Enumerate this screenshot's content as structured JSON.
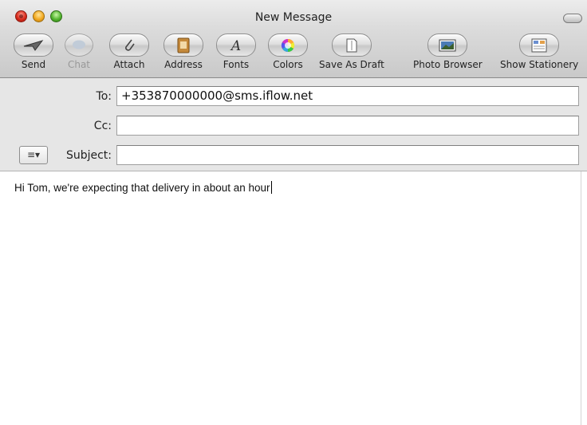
{
  "window": {
    "title": "New Message"
  },
  "toolbar": {
    "items": [
      {
        "label": "Send",
        "icon": "paper-plane-icon",
        "enabled": true
      },
      {
        "label": "Chat",
        "icon": "speech-bubble-icon",
        "enabled": false
      },
      {
        "label": "Attach",
        "icon": "paperclip-icon",
        "enabled": true
      },
      {
        "label": "Address",
        "icon": "address-book-icon",
        "enabled": true
      },
      {
        "label": "Fonts",
        "icon": "font-icon",
        "enabled": true
      },
      {
        "label": "Colors",
        "icon": "color-wheel-icon",
        "enabled": true
      },
      {
        "label": "Save As Draft",
        "icon": "draft-icon",
        "enabled": true
      },
      {
        "label": "Photo Browser",
        "icon": "photo-icon",
        "enabled": true
      },
      {
        "label": "Show Stationery",
        "icon": "stationery-icon",
        "enabled": true
      }
    ]
  },
  "fields": {
    "to_label": "To:",
    "to_value": "+353870000000@sms.iflow.net",
    "cc_label": "Cc:",
    "cc_value": "",
    "subject_label": "Subject:",
    "subject_value": "",
    "menu_button": "≡▾"
  },
  "body": {
    "text": "Hi Tom, we're expecting that delivery in about an hour"
  }
}
